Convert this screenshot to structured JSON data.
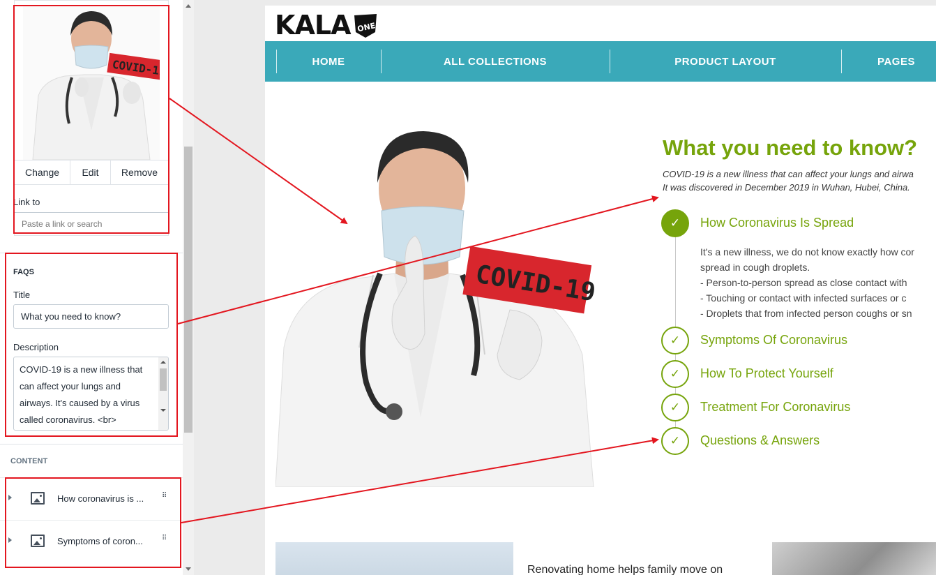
{
  "image_picker": {
    "actions": [
      "Change",
      "Edit",
      "Remove"
    ],
    "link_label": "Link to",
    "link_placeholder": "Paste a link or search"
  },
  "faqs_section": {
    "heading": "FAQS",
    "title_label": "Title",
    "title_value": "What you need to know?",
    "description_label": "Description",
    "description_value": "COVID-19 is a new illness that can affect your lungs and airways. It's caused by a virus called coronavirus. <br>"
  },
  "content_section": {
    "heading": "CONTENT",
    "items": [
      "How coronavirus is ...",
      "Symptoms of coron..."
    ]
  },
  "store": {
    "logo_text": "KALA",
    "logo_badge": "ONE",
    "nav": [
      "HOME",
      "ALL COLLECTIONS",
      "PRODUCT LAYOUT",
      "PAGES"
    ],
    "faq_title": "What you need to know?",
    "faq_description": [
      "COVID-19 is a new illness that can affect your lungs and airwa",
      "It was discovered in December 2019 in Wuhan, Hubei, China."
    ],
    "faq_items": [
      "How Coronavirus Is Spread",
      "Symptoms Of Coronavirus",
      "How To Protect Yourself",
      "Treatment For Coronavirus",
      "Questions & Answers"
    ],
    "faq_answer": [
      "It's a new illness, we do not know exactly how cor",
      "spread in cough droplets.",
      "- Person-to-person spread as close contact with",
      "- Touching or contact with infected surfaces or c",
      "- Droplets that from infected person coughs or sn"
    ],
    "photo_sign": "COVID-19",
    "bottom_text": "Renovating home helps family move on"
  },
  "colors": {
    "accent_green": "#76a40b",
    "nav_teal": "#3aa9b9",
    "annotation_red": "#e3161f"
  },
  "icons": [
    "check-icon",
    "image-icon",
    "drag-handle-icon",
    "caret-right-icon"
  ]
}
